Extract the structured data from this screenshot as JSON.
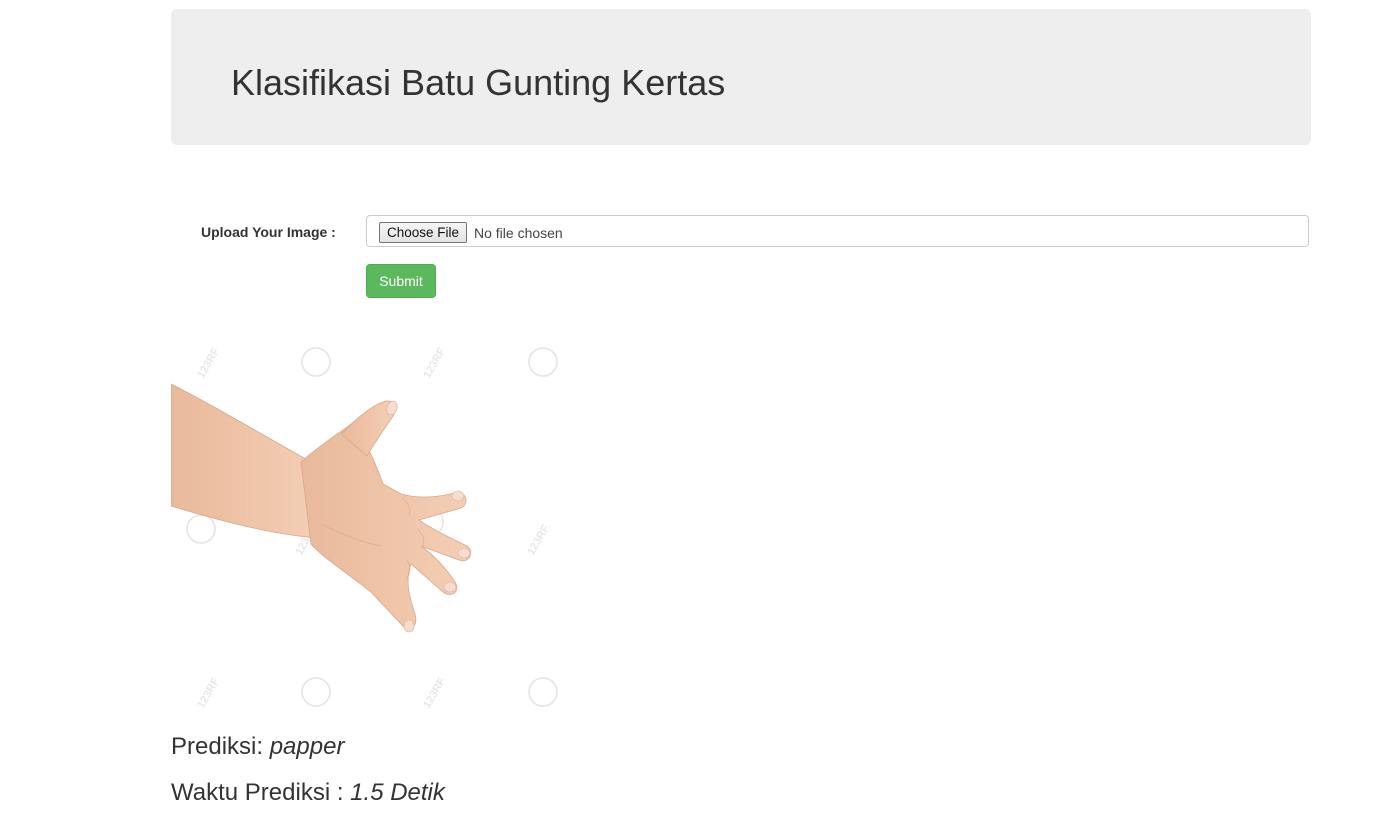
{
  "header": {
    "title": "Klasifikasi Batu Gunting Kertas"
  },
  "form": {
    "upload_label": "Upload Your Image :",
    "choose_file_label": "Choose File",
    "file_status": "No file chosen",
    "submit_label": "Submit"
  },
  "image": {
    "subject": "hand showing paper gesture",
    "watermark_text": "123RF"
  },
  "result": {
    "prediction_label": "Prediksi:",
    "prediction_value": "papper",
    "time_label": "Waktu Prediksi :",
    "time_value": "1.5 Detik"
  },
  "colors": {
    "jumbotron_bg": "#eeeeee",
    "submit_bg": "#5cb85c",
    "text": "#333333"
  }
}
